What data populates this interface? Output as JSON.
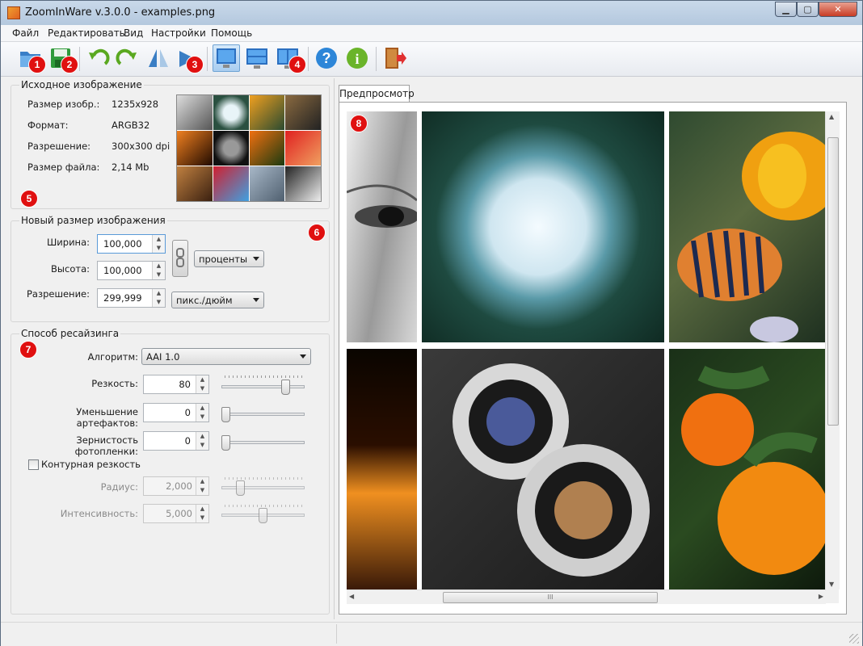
{
  "window": {
    "title": "ZoomInWare v.3.0.0 - examples.png"
  },
  "menu": [
    "Файл",
    "Редактировать",
    "Вид",
    "Настройки",
    "Помощь"
  ],
  "toolbar": {
    "buttons": [
      "open-folder-icon",
      "save-icon",
      "undo-icon",
      "redo-icon",
      "flip-icon",
      "rotate-icon",
      "view-single-icon",
      "view-horizontal-split-icon",
      "view-vertical-split-icon",
      "help-icon",
      "info-icon",
      "exit-icon"
    ],
    "active": "view-single-icon"
  },
  "badges": [
    "1",
    "2",
    "3",
    "4",
    "5",
    "6",
    "7",
    "8"
  ],
  "source": {
    "title": "Исходное изображение",
    "rows": [
      {
        "label": "Размер изобр.:",
        "value": "1235x928"
      },
      {
        "label": "Формат:",
        "value": "ARGB32"
      },
      {
        "label": "Разрешение:",
        "value": "300x300 dpi"
      },
      {
        "label": "Размер файла:",
        "value": "2,14 Mb"
      }
    ]
  },
  "new_size": {
    "title": "Новый размер изображения",
    "width_label": "Ширина:",
    "width_value": "100,000",
    "height_label": "Высота:",
    "height_value": "100,000",
    "resolution_label": "Разрешение:",
    "resolution_value": "299,999",
    "units": "проценты",
    "res_units": "пикс./дюйм"
  },
  "resize": {
    "title": "Способ ресайзинга",
    "algorithm_label": "Алгоритм:",
    "algorithm": "AAI 1.0",
    "sharpness_label": "Резкость:",
    "sharpness": "80",
    "sharpness_level": 0.8,
    "artifacts_label": "Уменьшение артефактов:",
    "artifacts": "0",
    "artifacts_level": 0,
    "grain_label": "Зернистость фотопленки:",
    "grain": "0",
    "grain_level": 0,
    "contour_label": "Контурная резкость",
    "radius_label": "Радиус:",
    "radius": "2,000",
    "radius_level": 0.2,
    "intensity_label": "Интенсивность:",
    "intensity": "5,000",
    "intensity_level": 0.5
  },
  "preview": {
    "tab": "Предпросмотр",
    "scroll_glyph": "III"
  },
  "colors": {
    "badge": "#e01010",
    "accent": "#3a8ad8"
  }
}
